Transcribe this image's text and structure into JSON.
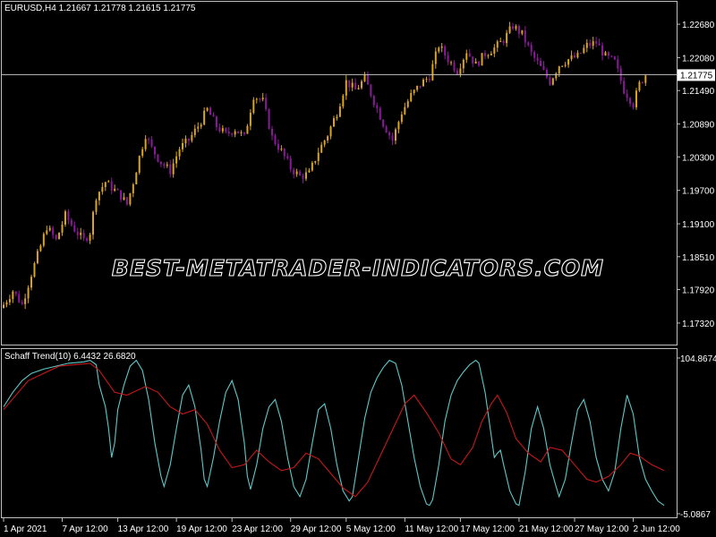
{
  "chart_data": [
    {
      "type": "candlestick",
      "symbol_header": "EURUSD,H4  1.21667 1.21778 1.21615 1.21775",
      "current_price": 1.21775,
      "current_price_label": "1.21775",
      "ylim": [
        1.1695,
        1.2305
      ],
      "y_ticks": [
        {
          "value": 1.2268,
          "label": "1.22680"
        },
        {
          "value": 1.2208,
          "label": "1.22080"
        },
        {
          "value": 1.2149,
          "label": "1.21490"
        },
        {
          "value": 1.2089,
          "label": "1.20890"
        },
        {
          "value": 1.203,
          "label": "1.20300"
        },
        {
          "value": 1.197,
          "label": "1.19700"
        },
        {
          "value": 1.191,
          "label": "1.19100"
        },
        {
          "value": 1.1851,
          "label": "1.18510"
        },
        {
          "value": 1.1792,
          "label": "1.17920"
        },
        {
          "value": 1.1732,
          "label": "1.17320"
        }
      ],
      "bull_color": "#DAA520",
      "bear_color": "#8B1A9B",
      "close_path": [
        [
          0,
          1.1765
        ],
        [
          3,
          1.179
        ],
        [
          6,
          1.1765
        ],
        [
          9,
          1.182
        ],
        [
          12,
          1.187
        ],
        [
          14,
          1.1905
        ],
        [
          17,
          1.188
        ],
        [
          20,
          1.1925
        ],
        [
          23,
          1.19
        ],
        [
          26,
          1.188
        ],
        [
          28,
          1.1895
        ],
        [
          30,
          1.196
        ],
        [
          33,
          1.1985
        ],
        [
          35,
          1.1975
        ],
        [
          38,
          1.196
        ],
        [
          40,
          1.1945
        ],
        [
          42,
          1.1985
        ],
        [
          44,
          1.203
        ],
        [
          46,
          1.207
        ],
        [
          48,
          1.2045
        ],
        [
          51,
          1.202
        ],
        [
          54,
          1.2005
        ],
        [
          57,
          1.2045
        ],
        [
          60,
          1.206
        ],
        [
          63,
          1.2085
        ],
        [
          66,
          1.2115
        ],
        [
          69,
          1.2085
        ],
        [
          72,
          1.207
        ],
        [
          75,
          1.208
        ],
        [
          78,
          1.2065
        ],
        [
          81,
          1.214
        ],
        [
          84,
          1.213
        ],
        [
          87,
          1.2065
        ],
        [
          90,
          1.204
        ],
        [
          93,
          1.201
        ],
        [
          96,
          1.1995
        ],
        [
          99,
          1.2
        ],
        [
          102,
          1.204
        ],
        [
          105,
          1.207
        ],
        [
          108,
          1.211
        ],
        [
          111,
          1.2165
        ],
        [
          114,
          1.215
        ],
        [
          117,
          1.217
        ],
        [
          120,
          1.213
        ],
        [
          123,
          1.209
        ],
        [
          126,
          1.206
        ],
        [
          129,
          1.211
        ],
        [
          132,
          1.214
        ],
        [
          135,
          1.216
        ],
        [
          138,
          1.2175
        ],
        [
          141,
          1.223
        ],
        [
          144,
          1.2205
        ],
        [
          147,
          1.2185
        ],
        [
          150,
          1.222
        ],
        [
          153,
          1.2195
        ],
        [
          156,
          1.2215
        ],
        [
          159,
          1.2225
        ],
        [
          162,
          1.224
        ],
        [
          165,
          1.2265
        ],
        [
          168,
          1.225
        ],
        [
          171,
          1.2215
        ],
        [
          174,
          1.219
        ],
        [
          177,
          1.2165
        ],
        [
          180,
          1.2195
        ],
        [
          183,
          1.2205
        ],
        [
          186,
          1.221
        ],
        [
          189,
          1.223
        ],
        [
          192,
          1.2235
        ],
        [
          195,
          1.221
        ],
        [
          198,
          1.22
        ],
        [
          201,
          1.215
        ],
        [
          204,
          1.2125
        ],
        [
          206,
          1.216
        ],
        [
          208,
          1.21775
        ]
      ]
    },
    {
      "type": "line",
      "header": "Schaff Trend(10) 6.4432 26.6820",
      "ylim": [
        -5,
        104.8674
      ],
      "y_ticks": [
        {
          "value": 104.8674,
          "label": "104.8674"
        },
        {
          "value": -5,
          "label": "-5.0867"
        }
      ],
      "series": [
        {
          "color": "#5FC8C8",
          "points": [
            [
              0,
              70
            ],
            [
              3,
              80
            ],
            [
              6,
              88
            ],
            [
              9,
              93
            ],
            [
              13,
              96
            ],
            [
              17,
              98
            ],
            [
              21,
              100
            ],
            [
              26,
              101
            ],
            [
              28,
              102
            ],
            [
              30,
              99
            ],
            [
              31,
              85
            ],
            [
              33,
              70
            ],
            [
              34,
              55
            ],
            [
              35,
              35
            ],
            [
              36,
              45
            ],
            [
              37,
              68
            ],
            [
              39,
              85
            ],
            [
              41,
              98
            ],
            [
              43,
              102
            ],
            [
              45,
              95
            ],
            [
              47,
              75
            ],
            [
              49,
              45
            ],
            [
              51,
              22
            ],
            [
              52,
              15
            ],
            [
              54,
              30
            ],
            [
              56,
              55
            ],
            [
              58,
              78
            ],
            [
              60,
              85
            ],
            [
              62,
              70
            ],
            [
              64,
              40
            ],
            [
              65,
              20
            ],
            [
              66,
              15
            ],
            [
              68,
              35
            ],
            [
              70,
              60
            ],
            [
              72,
              80
            ],
            [
              74,
              88
            ],
            [
              76,
              75
            ],
            [
              78,
              45
            ],
            [
              79,
              22
            ],
            [
              80,
              13
            ],
            [
              82,
              30
            ],
            [
              84,
              55
            ],
            [
              86,
              70
            ],
            [
              88,
              75
            ],
            [
              90,
              60
            ],
            [
              92,
              35
            ],
            [
              94,
              15
            ],
            [
              96,
              8
            ],
            [
              98,
              20
            ],
            [
              100,
              45
            ],
            [
              102,
              68
            ],
            [
              104,
              72
            ],
            [
              106,
              55
            ],
            [
              108,
              30
            ],
            [
              110,
              12
            ],
            [
              112,
              5
            ],
            [
              113,
              8
            ],
            [
              115,
              35
            ],
            [
              117,
              62
            ],
            [
              119,
              80
            ],
            [
              121,
              90
            ],
            [
              123,
              97
            ],
            [
              125,
              102
            ],
            [
              127,
              100
            ],
            [
              129,
              85
            ],
            [
              131,
              60
            ],
            [
              133,
              35
            ],
            [
              135,
              15
            ],
            [
              137,
              3
            ],
            [
              138,
              2
            ],
            [
              139,
              6
            ],
            [
              141,
              30
            ],
            [
              143,
              60
            ],
            [
              145,
              78
            ],
            [
              147,
              88
            ],
            [
              149,
              94
            ],
            [
              151,
              99
            ],
            [
              153,
              102
            ],
            [
              154,
              100
            ],
            [
              156,
              80
            ],
            [
              158,
              50
            ],
            [
              159,
              35
            ],
            [
              160,
              38
            ],
            [
              161,
              40
            ],
            [
              162,
              30
            ],
            [
              164,
              12
            ],
            [
              166,
              3
            ],
            [
              167,
              2
            ],
            [
              169,
              25
            ],
            [
              171,
              55
            ],
            [
              173,
              70
            ],
            [
              175,
              55
            ],
            [
              177,
              30
            ],
            [
              179,
              15
            ],
            [
              180,
              8
            ],
            [
              182,
              20
            ],
            [
              184,
              45
            ],
            [
              186,
              68
            ],
            [
              188,
              75
            ],
            [
              190,
              60
            ],
            [
              192,
              35
            ],
            [
              194,
              20
            ],
            [
              196,
              12
            ],
            [
              198,
              25
            ],
            [
              200,
              55
            ],
            [
              202,
              78
            ],
            [
              204,
              65
            ],
            [
              206,
              35
            ],
            [
              208,
              20
            ],
            [
              210,
              12
            ],
            [
              212,
              5
            ],
            [
              214,
              2
            ]
          ]
        },
        {
          "color": "#C81818",
          "points": [
            [
              0,
              68
            ],
            [
              8,
              88
            ],
            [
              18,
              98
            ],
            [
              28,
              100
            ],
            [
              31,
              95
            ],
            [
              36,
              80
            ],
            [
              40,
              78
            ],
            [
              46,
              84
            ],
            [
              50,
              80
            ],
            [
              54,
              70
            ],
            [
              58,
              65
            ],
            [
              62,
              68
            ],
            [
              66,
              58
            ],
            [
              70,
              40
            ],
            [
              74,
              28
            ],
            [
              78,
              30
            ],
            [
              82,
              40
            ],
            [
              86,
              32
            ],
            [
              90,
              26
            ],
            [
              94,
              28
            ],
            [
              98,
              38
            ],
            [
              102,
              34
            ],
            [
              106,
              24
            ],
            [
              110,
              14
            ],
            [
              114,
              8
            ],
            [
              118,
              18
            ],
            [
              122,
              36
            ],
            [
              126,
              54
            ],
            [
              130,
              72
            ],
            [
              133,
              78
            ],
            [
              137,
              66
            ],
            [
              141,
              52
            ],
            [
              145,
              34
            ],
            [
              148,
              30
            ],
            [
              152,
              42
            ],
            [
              155,
              60
            ],
            [
              158,
              72
            ],
            [
              160,
              78
            ],
            [
              163,
              66
            ],
            [
              166,
              48
            ],
            [
              170,
              38
            ],
            [
              174,
              32
            ],
            [
              177,
              42
            ],
            [
              181,
              40
            ],
            [
              185,
              30
            ],
            [
              189,
              20
            ],
            [
              192,
              18
            ],
            [
              196,
              22
            ],
            [
              200,
              30
            ],
            [
              203,
              38
            ],
            [
              206,
              36
            ],
            [
              210,
              30
            ],
            [
              214,
              26
            ]
          ]
        }
      ]
    }
  ],
  "x_axis": {
    "ticks": [
      {
        "i": 0,
        "label": "1 Apr 2021"
      },
      {
        "i": 19,
        "label": "7 Apr 12:00"
      },
      {
        "i": 37,
        "label": "13 Apr 12:00"
      },
      {
        "i": 56,
        "label": "19 Apr 12:00"
      },
      {
        "i": 74,
        "label": "23 Apr 12:00"
      },
      {
        "i": 93,
        "label": "29 Apr 12:00"
      },
      {
        "i": 111,
        "label": "5 May 12:00"
      },
      {
        "i": 130,
        "label": "11 May 12:00"
      },
      {
        "i": 148,
        "label": "17 May 12:00"
      },
      {
        "i": 167,
        "label": "21 May 12:00"
      },
      {
        "i": 185,
        "label": "27 May 12:00"
      },
      {
        "i": 204,
        "label": "2 Jun 12:00"
      }
    ],
    "bar_count": 215
  },
  "watermark": "BEST-METATRADER-INDICATORS.COM",
  "colors": {
    "background": "#000000",
    "frame": "#C0C0C0",
    "text": "#FFFFFF",
    "price_line": "#C0C0C0"
  }
}
